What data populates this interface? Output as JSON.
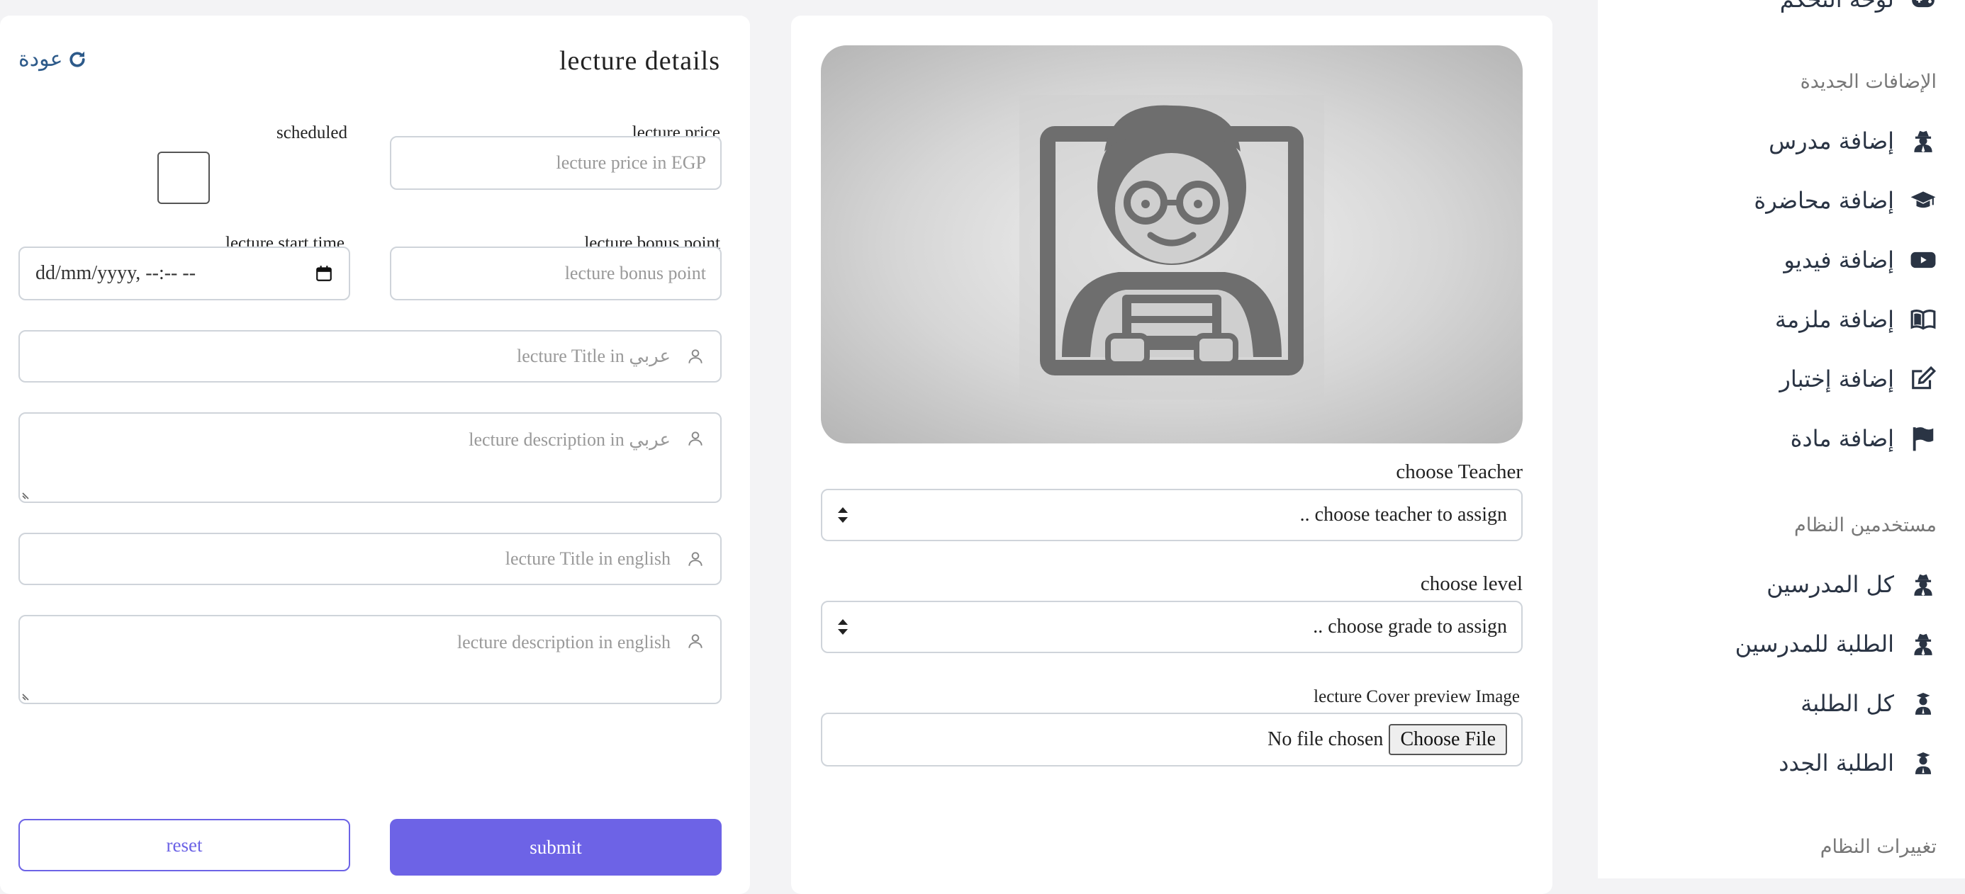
{
  "form": {
    "title": "lecture details",
    "back_label": "عودة",
    "price_label": "lecture price",
    "price_placeholder": "lecture price in EGP",
    "scheduled_label": "scheduled",
    "bonus_label": "lecture bonus point",
    "bonus_placeholder": "lecture bonus point",
    "start_time_label": "lecture start time",
    "start_time_value": "dd/mm/yyyy, --:-- --",
    "title_ar_placeholder": "lecture Title in عربي",
    "desc_ar_placeholder": "lecture description in عربي",
    "title_en_placeholder": "lecture Title in english",
    "desc_en_placeholder": "lecture description in english",
    "reset_label": "reset",
    "submit_label": "submit"
  },
  "preview": {
    "teacher_label": "choose Teacher",
    "teacher_value": ".. choose teacher to assign",
    "level_label": "choose level",
    "level_value": ".. choose grade to assign",
    "cover_label": "lecture Cover preview Image",
    "file_status": "No file chosen",
    "choose_file_label": "Choose File"
  },
  "sidebar": {
    "top_item": "لوحة التحكم",
    "section_new": "الإضافات الجديدة",
    "new_items": [
      {
        "label": "إضافة مدرس",
        "icon": "user-secret-icon"
      },
      {
        "label": "إضافة محاضرة",
        "icon": "graduation-cap-icon"
      },
      {
        "label": "إضافة فيديو",
        "icon": "youtube-icon"
      },
      {
        "label": "إضافة ملزمة",
        "icon": "book-open-icon"
      },
      {
        "label": "إضافة إختبار",
        "icon": "edit-icon"
      },
      {
        "label": "إضافة مادة",
        "icon": "flag-icon"
      }
    ],
    "section_users": "مستخدمين النظام",
    "user_items": [
      {
        "label": "كل المدرسين",
        "icon": "user-secret-icon"
      },
      {
        "label": "الطلبة للمدرسين",
        "icon": "user-secret-icon"
      },
      {
        "label": "كل الطلبة",
        "icon": "student-icon"
      },
      {
        "label": "الطلبة الجدد",
        "icon": "student-icon"
      }
    ],
    "section_system": "تغييرات النظام"
  },
  "colors": {
    "accent": "#6d63e6",
    "link": "#2d5a8a",
    "border": "#cfd4da",
    "sidebar_text": "#2a3444"
  }
}
